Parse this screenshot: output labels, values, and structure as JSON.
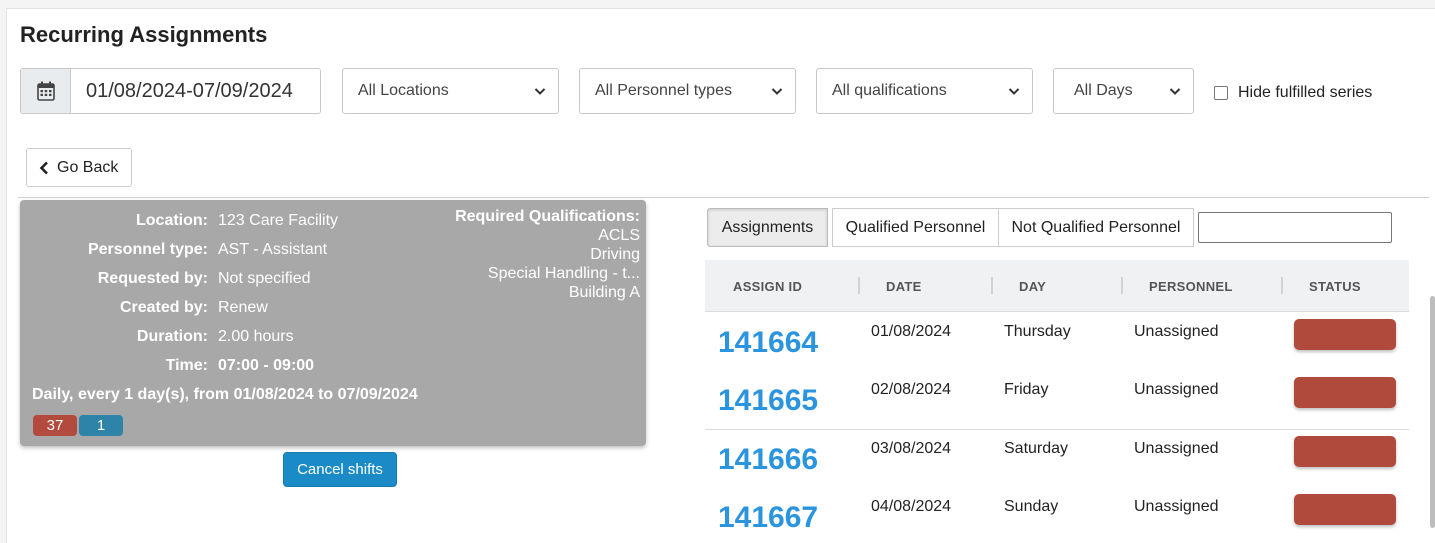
{
  "page": {
    "title": "Recurring Assignments"
  },
  "filters": {
    "date_range": "01/08/2024-07/09/2024",
    "location": "All Locations",
    "personnel_type": "All Personnel types",
    "qualifications": "All qualifications",
    "days": "All Days",
    "hide_fulfilled_label": "Hide fulfilled series",
    "hide_fulfilled_checked": false
  },
  "nav": {
    "go_back_label": "Go Back"
  },
  "summary": {
    "fields": [
      {
        "label": "Location:",
        "value": "123 Care Facility"
      },
      {
        "label": "Personnel type:",
        "value": "AST - Assistant"
      },
      {
        "label": "Requested by:",
        "value": "Not specified"
      },
      {
        "label": "Created by:",
        "value": "Renew"
      },
      {
        "label": "Duration:",
        "value": "2.00 hours"
      },
      {
        "label": "Time:",
        "value": "07:00 - 09:00"
      }
    ],
    "recurrence": "Daily, every 1 day(s), from 01/08/2024 to 07/09/2024",
    "badges": {
      "unfilled_count": "37",
      "filled_count": "1"
    },
    "required_qualifications_title": "Required Qualifications:",
    "required_qualifications": [
      "ACLS",
      "Driving",
      "Special Handling - t...",
      "Building A"
    ],
    "cancel_label": "Cancel shifts"
  },
  "tabs": {
    "assignments": "Assignments",
    "qualified": "Qualified Personnel",
    "not_qualified": "Not Qualified Personnel",
    "active": "assignments",
    "search_value": ""
  },
  "table": {
    "headers": [
      "ASSIGN ID",
      "DATE",
      "DAY",
      "PERSONNEL",
      "STATUS"
    ],
    "rows": [
      {
        "id": "141664",
        "date": "01/08/2024",
        "day": "Thursday",
        "personnel": "Unassigned",
        "status_color": "#b04a3c"
      },
      {
        "id": "141665",
        "date": "02/08/2024",
        "day": "Friday",
        "personnel": "Unassigned",
        "status_color": "#b04a3c"
      },
      {
        "id": "141666",
        "date": "03/08/2024",
        "day": "Saturday",
        "personnel": "Unassigned",
        "status_color": "#b04a3c"
      },
      {
        "id": "141667",
        "date": "04/08/2024",
        "day": "Sunday",
        "personnel": "Unassigned",
        "status_color": "#b04a3c"
      }
    ]
  },
  "colors": {
    "link": "#2a94de",
    "danger": "#b04a3c",
    "info": "#2d83a8",
    "primary": "#1a8bc6"
  },
  "icons": {
    "date": "calendar-icon",
    "select": "chevron-down-icon",
    "back": "chevron-left-icon"
  }
}
